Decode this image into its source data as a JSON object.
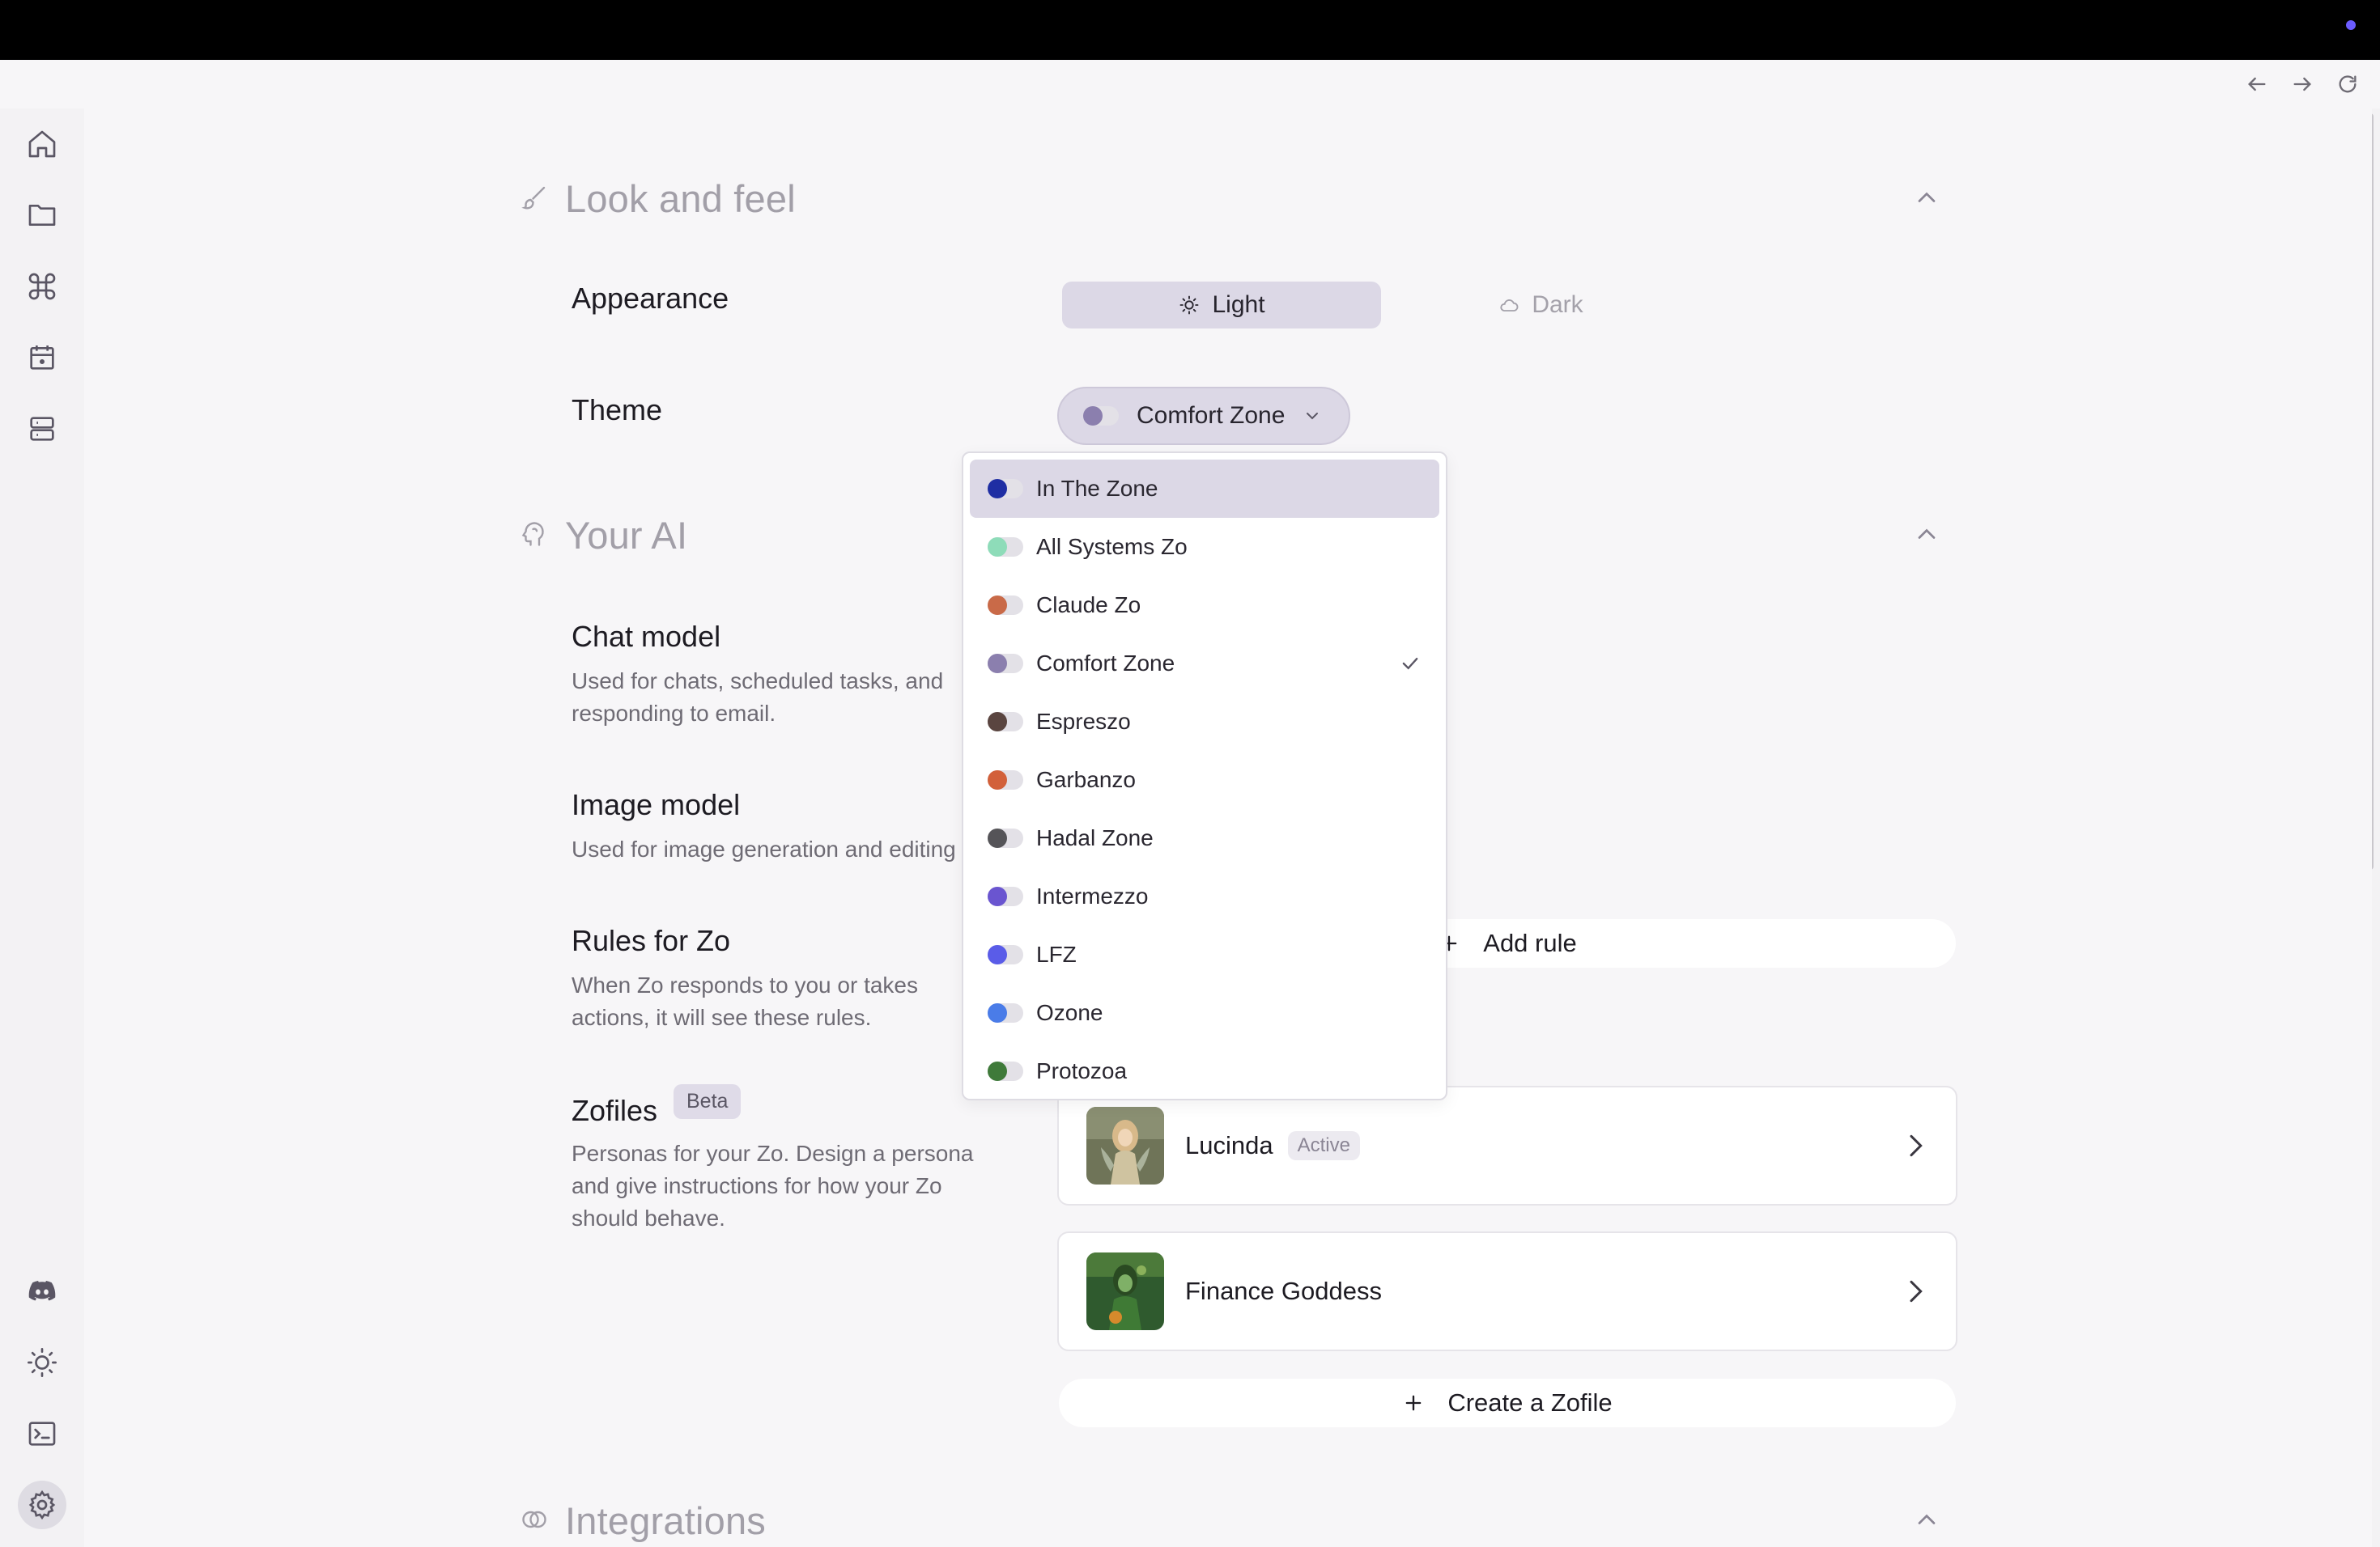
{
  "colors": {
    "accent": "#6b5cff",
    "selected_bg": "#dcd8e6"
  },
  "look_and_feel": {
    "title": "Look and feel",
    "appearance": {
      "label": "Appearance",
      "options": [
        "Light",
        "Dark"
      ],
      "selected": "Light"
    },
    "theme": {
      "label": "Theme",
      "selected": "Comfort Zone",
      "dropdown": [
        {
          "label": "In The Zone",
          "color": "#1f2ea3",
          "highlighted": true,
          "checked": false
        },
        {
          "label": "All Systems Zo",
          "color": "#8edcb9",
          "highlighted": false,
          "checked": false
        },
        {
          "label": "Claude Zo",
          "color": "#c96a48",
          "highlighted": false,
          "checked": false
        },
        {
          "label": "Comfort Zone",
          "color": "#8b7fae",
          "highlighted": false,
          "checked": true
        },
        {
          "label": "Espreszo",
          "color": "#5a4540",
          "highlighted": false,
          "checked": false
        },
        {
          "label": "Garbanzo",
          "color": "#d2603a",
          "highlighted": false,
          "checked": false
        },
        {
          "label": "Hadal Zone",
          "color": "#555458",
          "highlighted": false,
          "checked": false
        },
        {
          "label": "Intermezzo",
          "color": "#6a55d0",
          "highlighted": false,
          "checked": false
        },
        {
          "label": "LFZ",
          "color": "#5a5ce8",
          "highlighted": false,
          "checked": false
        },
        {
          "label": "Ozone",
          "color": "#4a7ce8",
          "highlighted": false,
          "checked": false
        },
        {
          "label": "Protozoa",
          "color": "#3f7a3a",
          "highlighted": false,
          "checked": false
        }
      ]
    }
  },
  "your_ai": {
    "title": "Your AI",
    "chat_model": {
      "label": "Chat model",
      "desc_line1": "Used for chats, scheduled tasks, and",
      "desc_line2": "responding to email."
    },
    "image_model": {
      "label": "Image model",
      "desc": "Used for image generation and editing"
    },
    "rules": {
      "label": "Rules for Zo",
      "desc_line1": "When Zo responds to you or takes",
      "desc_line2": "actions, it will see these rules.",
      "add_label": "Add rule"
    },
    "zofiles": {
      "label": "Zofiles",
      "badge": "Beta",
      "desc_line1": "Personas for your Zo. Design a persona",
      "desc_line2": "and give instructions for how your Zo",
      "desc_line3": "should behave.",
      "items": [
        {
          "name": "Lucinda",
          "status": "Active"
        },
        {
          "name": "Finance Goddess",
          "status": ""
        }
      ],
      "create_label": "Create a Zofile"
    }
  },
  "integrations": {
    "title": "Integrations"
  },
  "sidebar": {
    "top": [
      "home-icon",
      "folder-icon",
      "command-icon",
      "calendar-icon",
      "server-icon"
    ],
    "bottom": [
      "discord-icon",
      "sun-icon",
      "terminal-icon",
      "gear-icon"
    ],
    "active": "gear-icon"
  }
}
